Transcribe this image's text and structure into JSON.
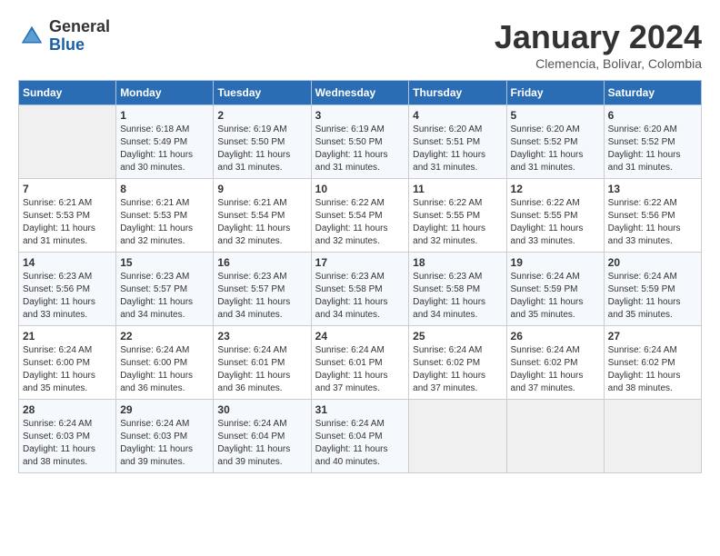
{
  "header": {
    "logo_general": "General",
    "logo_blue": "Blue",
    "month_title": "January 2024",
    "location": "Clemencia, Bolivar, Colombia"
  },
  "calendar": {
    "weekdays": [
      "Sunday",
      "Monday",
      "Tuesday",
      "Wednesday",
      "Thursday",
      "Friday",
      "Saturday"
    ],
    "weeks": [
      [
        {
          "day": "",
          "info": ""
        },
        {
          "day": "1",
          "info": "Sunrise: 6:18 AM\nSunset: 5:49 PM\nDaylight: 11 hours and 30 minutes."
        },
        {
          "day": "2",
          "info": "Sunrise: 6:19 AM\nSunset: 5:50 PM\nDaylight: 11 hours and 31 minutes."
        },
        {
          "day": "3",
          "info": "Sunrise: 6:19 AM\nSunset: 5:50 PM\nDaylight: 11 hours and 31 minutes."
        },
        {
          "day": "4",
          "info": "Sunrise: 6:20 AM\nSunset: 5:51 PM\nDaylight: 11 hours and 31 minutes."
        },
        {
          "day": "5",
          "info": "Sunrise: 6:20 AM\nSunset: 5:52 PM\nDaylight: 11 hours and 31 minutes."
        },
        {
          "day": "6",
          "info": "Sunrise: 6:20 AM\nSunset: 5:52 PM\nDaylight: 11 hours and 31 minutes."
        }
      ],
      [
        {
          "day": "7",
          "info": "Sunrise: 6:21 AM\nSunset: 5:53 PM\nDaylight: 11 hours and 31 minutes."
        },
        {
          "day": "8",
          "info": "Sunrise: 6:21 AM\nSunset: 5:53 PM\nDaylight: 11 hours and 32 minutes."
        },
        {
          "day": "9",
          "info": "Sunrise: 6:21 AM\nSunset: 5:54 PM\nDaylight: 11 hours and 32 minutes."
        },
        {
          "day": "10",
          "info": "Sunrise: 6:22 AM\nSunset: 5:54 PM\nDaylight: 11 hours and 32 minutes."
        },
        {
          "day": "11",
          "info": "Sunrise: 6:22 AM\nSunset: 5:55 PM\nDaylight: 11 hours and 32 minutes."
        },
        {
          "day": "12",
          "info": "Sunrise: 6:22 AM\nSunset: 5:55 PM\nDaylight: 11 hours and 33 minutes."
        },
        {
          "day": "13",
          "info": "Sunrise: 6:22 AM\nSunset: 5:56 PM\nDaylight: 11 hours and 33 minutes."
        }
      ],
      [
        {
          "day": "14",
          "info": "Sunrise: 6:23 AM\nSunset: 5:56 PM\nDaylight: 11 hours and 33 minutes."
        },
        {
          "day": "15",
          "info": "Sunrise: 6:23 AM\nSunset: 5:57 PM\nDaylight: 11 hours and 34 minutes."
        },
        {
          "day": "16",
          "info": "Sunrise: 6:23 AM\nSunset: 5:57 PM\nDaylight: 11 hours and 34 minutes."
        },
        {
          "day": "17",
          "info": "Sunrise: 6:23 AM\nSunset: 5:58 PM\nDaylight: 11 hours and 34 minutes."
        },
        {
          "day": "18",
          "info": "Sunrise: 6:23 AM\nSunset: 5:58 PM\nDaylight: 11 hours and 34 minutes."
        },
        {
          "day": "19",
          "info": "Sunrise: 6:24 AM\nSunset: 5:59 PM\nDaylight: 11 hours and 35 minutes."
        },
        {
          "day": "20",
          "info": "Sunrise: 6:24 AM\nSunset: 5:59 PM\nDaylight: 11 hours and 35 minutes."
        }
      ],
      [
        {
          "day": "21",
          "info": "Sunrise: 6:24 AM\nSunset: 6:00 PM\nDaylight: 11 hours and 35 minutes."
        },
        {
          "day": "22",
          "info": "Sunrise: 6:24 AM\nSunset: 6:00 PM\nDaylight: 11 hours and 36 minutes."
        },
        {
          "day": "23",
          "info": "Sunrise: 6:24 AM\nSunset: 6:01 PM\nDaylight: 11 hours and 36 minutes."
        },
        {
          "day": "24",
          "info": "Sunrise: 6:24 AM\nSunset: 6:01 PM\nDaylight: 11 hours and 37 minutes."
        },
        {
          "day": "25",
          "info": "Sunrise: 6:24 AM\nSunset: 6:02 PM\nDaylight: 11 hours and 37 minutes."
        },
        {
          "day": "26",
          "info": "Sunrise: 6:24 AM\nSunset: 6:02 PM\nDaylight: 11 hours and 37 minutes."
        },
        {
          "day": "27",
          "info": "Sunrise: 6:24 AM\nSunset: 6:02 PM\nDaylight: 11 hours and 38 minutes."
        }
      ],
      [
        {
          "day": "28",
          "info": "Sunrise: 6:24 AM\nSunset: 6:03 PM\nDaylight: 11 hours and 38 minutes."
        },
        {
          "day": "29",
          "info": "Sunrise: 6:24 AM\nSunset: 6:03 PM\nDaylight: 11 hours and 39 minutes."
        },
        {
          "day": "30",
          "info": "Sunrise: 6:24 AM\nSunset: 6:04 PM\nDaylight: 11 hours and 39 minutes."
        },
        {
          "day": "31",
          "info": "Sunrise: 6:24 AM\nSunset: 6:04 PM\nDaylight: 11 hours and 40 minutes."
        },
        {
          "day": "",
          "info": ""
        },
        {
          "day": "",
          "info": ""
        },
        {
          "day": "",
          "info": ""
        }
      ]
    ]
  }
}
